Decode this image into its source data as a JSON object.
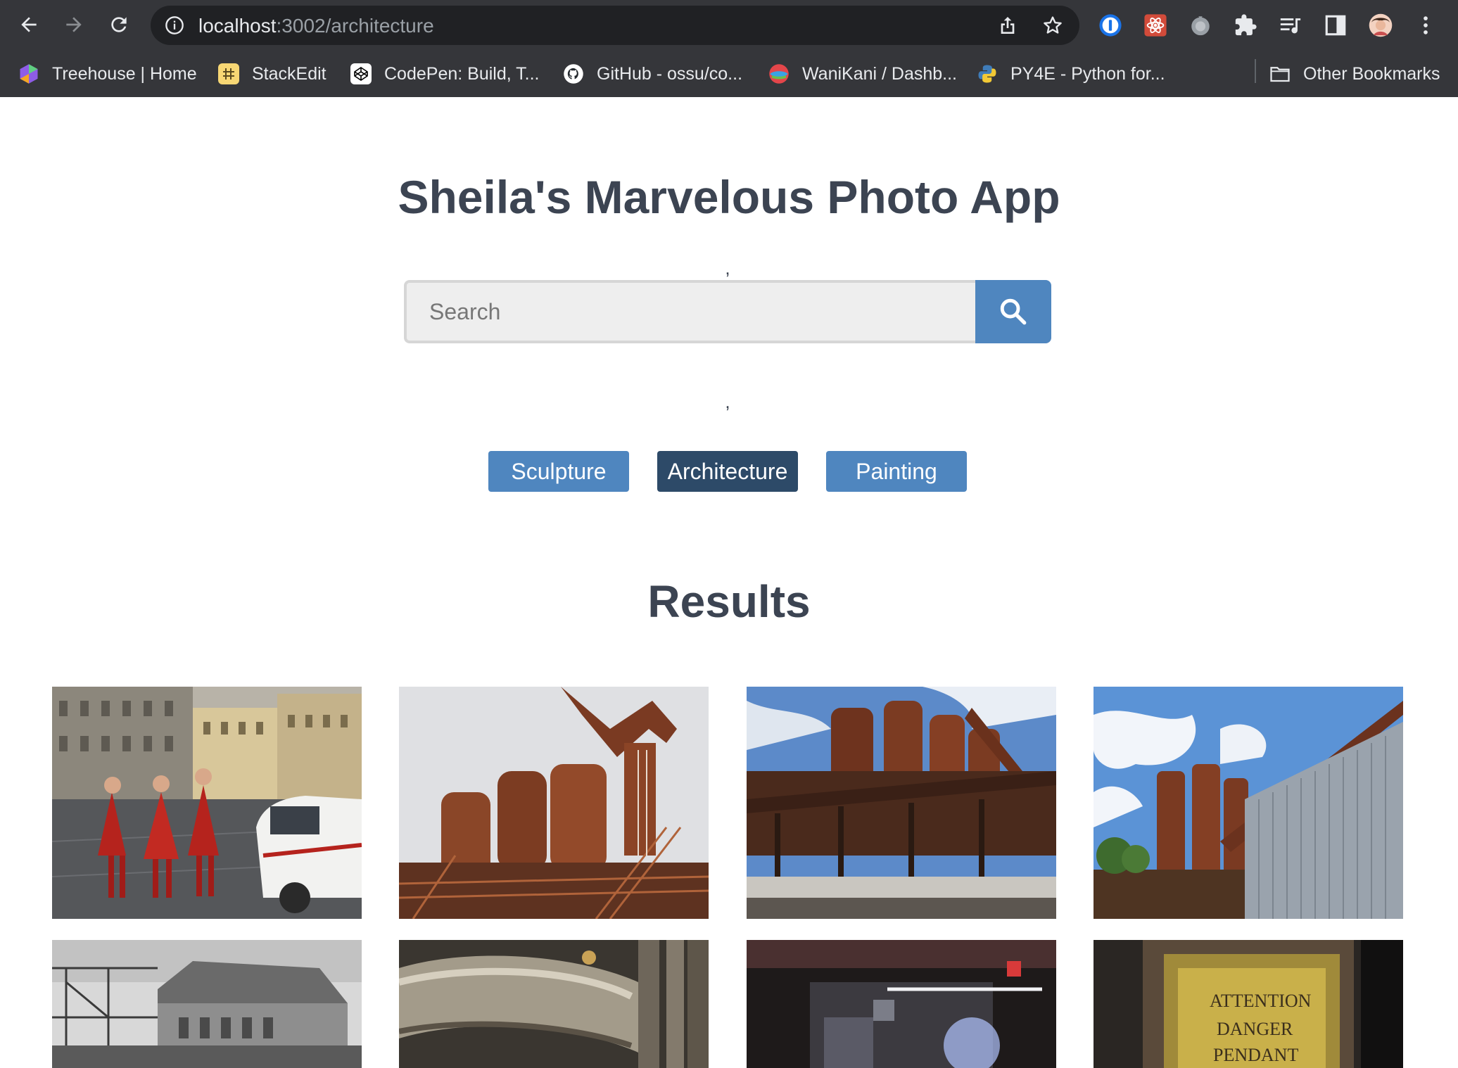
{
  "browser": {
    "url_host": "localhost",
    "url_path": ":3002/architecture",
    "bookmarks": [
      {
        "label": "Treehouse | Home"
      },
      {
        "label": "StackEdit"
      },
      {
        "label": "CodePen: Build, T..."
      },
      {
        "label": "GitHub - ossu/co..."
      },
      {
        "label": "WaniKani / Dashb..."
      },
      {
        "label": "PY4E - Python for..."
      }
    ],
    "other_bookmarks": "Other Bookmarks"
  },
  "app": {
    "title": "Sheila's Marvelous Photo App",
    "stray_text": ",",
    "search": {
      "placeholder": "Search",
      "value": ""
    },
    "categories": [
      {
        "label": "Sculpture",
        "active": false
      },
      {
        "label": "Architecture",
        "active": true
      },
      {
        "label": "Painting",
        "active": false
      }
    ],
    "results_title": "Results",
    "results": [
      {
        "subject": "piazza-street-scene"
      },
      {
        "subject": "rusty-blast-furnace"
      },
      {
        "subject": "rusty-industrial-towers"
      },
      {
        "subject": "steelworks-with-metal-wall"
      },
      {
        "subject": "black-white-factory"
      },
      {
        "subject": "industrial-pipes"
      },
      {
        "subject": "dark-factory-interior"
      },
      {
        "subject": "rusty-danger-sign"
      }
    ]
  },
  "colors": {
    "primary_button": "#4f86bf",
    "active_button": "#2d4a68",
    "heading": "#3c4452",
    "chrome_bg": "#35363a"
  }
}
